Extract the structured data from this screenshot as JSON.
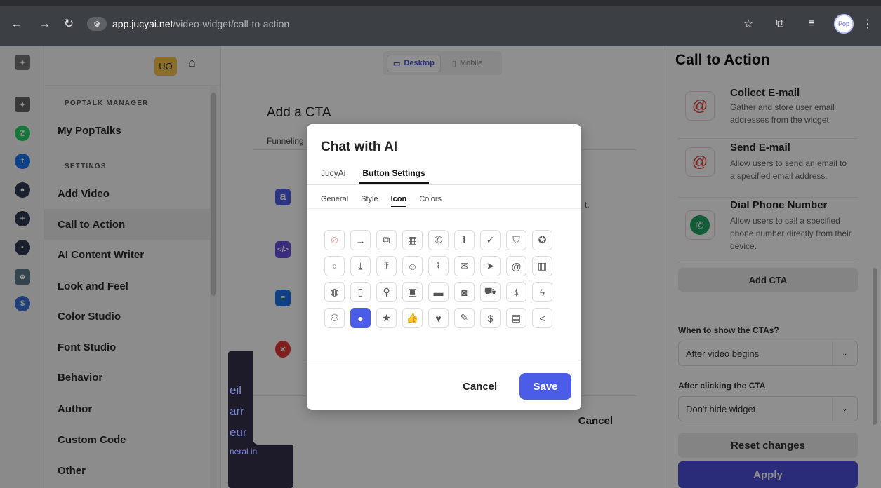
{
  "browser": {
    "url_host": "app.jucyai.net",
    "url_path": "/video-widget/call-to-action",
    "profile_label": "Pop",
    "back_icon": "arrow-left-icon",
    "forward_icon": "arrow-right-icon",
    "reload_icon": "reload-icon"
  },
  "sidebar": {
    "badge": "UO",
    "section1": "POPTALK MANAGER",
    "section2": "SETTINGS",
    "items": [
      {
        "label": "My PopTalks"
      },
      {
        "label": "Add Video"
      },
      {
        "label": "Call to Action"
      },
      {
        "label": "AI Content Writer"
      },
      {
        "label": "Look and Feel"
      },
      {
        "label": "Color Studio"
      },
      {
        "label": "Font Studio"
      },
      {
        "label": "Behavior"
      },
      {
        "label": "Author"
      },
      {
        "label": "Custom Code"
      },
      {
        "label": "Other"
      }
    ],
    "active": "Call to Action"
  },
  "preview": {
    "desktop_label": "Desktop",
    "mobile_label": "Mobile",
    "active": "Desktop"
  },
  "right_panel": {
    "title": "Call to Action",
    "ctas": [
      {
        "title": "Collect E-mail",
        "desc": "Gather and store user email addresses from the widget."
      },
      {
        "title": "Send E-mail",
        "desc": "Allow users to send an email to a specified email address."
      },
      {
        "title": "Dial Phone Number",
        "desc": "Allow users to call a specified phone number directly from their device."
      }
    ],
    "add_cta": "Add CTA",
    "when_label": "When to show the CTAs?",
    "when_value": "After video begins",
    "after_label": "After clicking the CTA",
    "after_value": "Don't hide widget",
    "reset": "Reset changes",
    "apply": "Apply"
  },
  "add_cta_modal": {
    "title": "Add a CTA",
    "tab": "Funneling",
    "trailing_text": "t.",
    "cancel": "Cancel",
    "card_texts": [
      "eil",
      "arr",
      "eur",
      "neral in"
    ]
  },
  "chat_modal": {
    "title": "Chat with AI",
    "tabs": [
      "JucyAi",
      "Button Settings"
    ],
    "active_tab": "Button Settings",
    "subtabs": [
      "General",
      "Style",
      "Icon",
      "Colors"
    ],
    "active_subtab": "Icon",
    "icons": [
      "⊘",
      "→",
      "⧉",
      "▦",
      "✆",
      "ℹ",
      "✓",
      "⛉",
      "✪",
      "⌕",
      "⤓",
      "⤒",
      "☺",
      "⌇",
      "✉",
      "➤",
      "@",
      "▥",
      "◍",
      "▯",
      "⚲",
      "▣",
      "▬",
      "◙",
      "⛟",
      "⍋",
      "ϟ",
      "⚇",
      "●",
      "★",
      "👍",
      "♥",
      "✎",
      "$",
      "▤",
      "<"
    ],
    "selected_icon_index": 28,
    "cancel": "Cancel",
    "save": "Save"
  }
}
